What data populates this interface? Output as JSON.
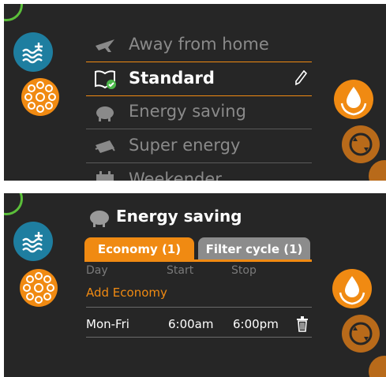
{
  "top_panel": {
    "menu": [
      {
        "label": "Away from home",
        "icon": "airplane-icon",
        "selected": false
      },
      {
        "label": "Standard",
        "icon": "book-check-icon",
        "selected": true
      },
      {
        "label": "Energy saving",
        "icon": "piggy-bank-icon",
        "selected": false
      },
      {
        "label": "Super energy",
        "icon": "money-stack-icon",
        "selected": false
      },
      {
        "label": "Weekender",
        "icon": "calendar-icon",
        "selected": false
      }
    ],
    "edit_icon": "pencil-icon"
  },
  "bottom_panel": {
    "title": "Energy saving",
    "title_icon": "piggy-bank-icon",
    "tabs": [
      {
        "label": "Economy (1)",
        "active": true
      },
      {
        "label": "Filter cycle (1)",
        "active": false
      }
    ],
    "columns": {
      "day": "Day",
      "start": "Start",
      "stop": "Stop"
    },
    "add_label": "Add Economy",
    "rows": [
      {
        "day": "Mon-Fri",
        "start": "6:00am",
        "stop": "6:00pm"
      }
    ],
    "delete_icon": "trash-icon"
  },
  "colors": {
    "accent": "#f08a12",
    "teal": "#1e7ea0",
    "panel": "#262626",
    "inactive_tab": "#8c8c8c"
  }
}
